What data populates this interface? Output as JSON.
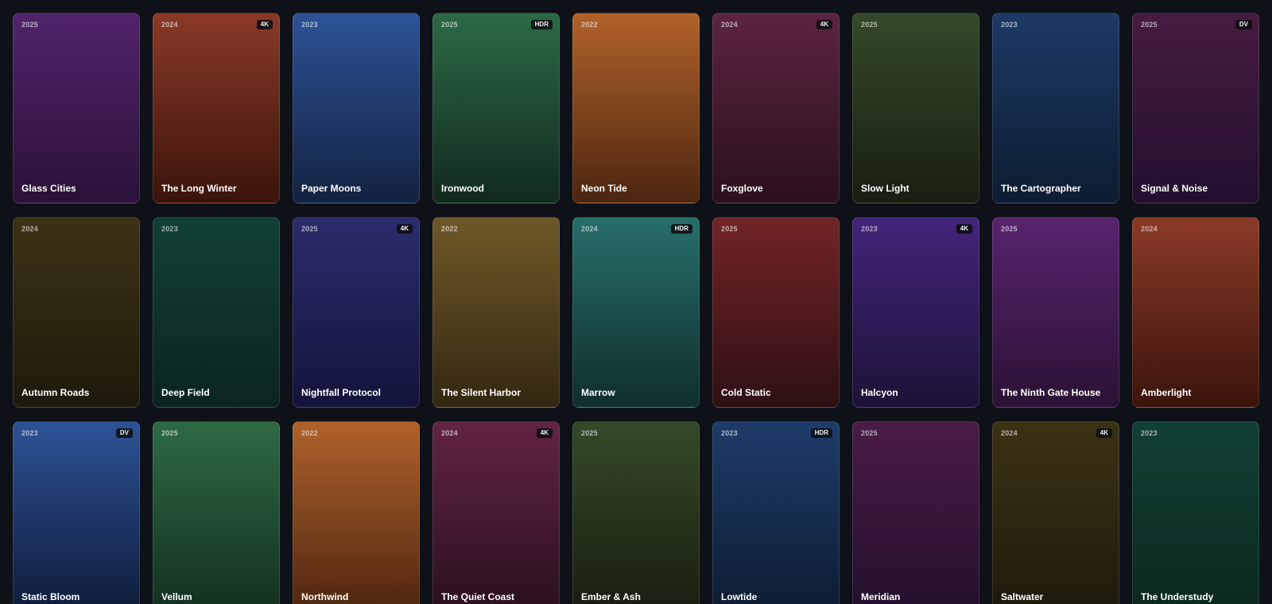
{
  "cards": [
    {
      "year": "2025",
      "badge": "",
      "title": "Glass Cities",
      "top": "#51246a",
      "bottom": "#2a1138"
    },
    {
      "year": "2024",
      "badge": "4K",
      "title": "The Long Winter",
      "top": "#8a3a27",
      "bottom": "#3a140c"
    },
    {
      "year": "2023",
      "badge": "",
      "title": "Paper Moons",
      "top": "#2c5296",
      "bottom": "#132240"
    },
    {
      "year": "2025",
      "badge": "HDR",
      "title": "Ironwood",
      "top": "#2b6a45",
      "bottom": "#112a1e"
    },
    {
      "year": "2022",
      "badge": "",
      "title": "Neon Tide",
      "top": "#b0622a",
      "bottom": "#4c260f"
    },
    {
      "year": "2024",
      "badge": "4K",
      "title": "Foxglove",
      "top": "#5c2440",
      "bottom": "#2a101c"
    },
    {
      "year": "2025",
      "badge": "",
      "title": "Slow Light",
      "top": "#34492a",
      "bottom": "#181e10"
    },
    {
      "year": "2023",
      "badge": "",
      "title": "The Cartographer",
      "top": "#1c3a66",
      "bottom": "#0d1c30"
    },
    {
      "year": "2025",
      "badge": "DV",
      "title": "Signal & Noise",
      "top": "#461c40",
      "bottom": "#22102e"
    },
    {
      "year": "2024",
      "badge": "",
      "title": "Autumn Roads",
      "top": "#3c3214",
      "bottom": "#1e1a0c"
    },
    {
      "year": "2023",
      "badge": "",
      "title": "Deep Field",
      "top": "#124034",
      "bottom": "#0b2420"
    },
    {
      "year": "2025",
      "badge": "4K",
      "title": "Nightfall Protocol",
      "top": "#2a2c6c",
      "bottom": "#13143a"
    },
    {
      "year": "2022",
      "badge": "",
      "title": "The Silent Harbor",
      "top": "#6e5828",
      "bottom": "#332810"
    },
    {
      "year": "2024",
      "badge": "HDR",
      "title": "Marrow",
      "top": "#276e6a",
      "bottom": "#0f2e2c"
    },
    {
      "year": "2025",
      "badge": "",
      "title": "Cold Static",
      "top": "#722428",
      "bottom": "#2e1012"
    },
    {
      "year": "2023",
      "badge": "4K",
      "title": "Halcyon",
      "top": "#44247a",
      "bottom": "#1c1236"
    },
    {
      "year": "2025",
      "badge": "",
      "title": "The Ninth Gate House",
      "top": "#58246e",
      "bottom": "#2a1234"
    },
    {
      "year": "2024",
      "badge": "",
      "title": "Amberlight",
      "top": "#8a3a26",
      "bottom": "#3a140c"
    },
    {
      "year": "2023",
      "badge": "DV",
      "title": "Static Bloom",
      "top": "#2c5296",
      "bottom": "#0f1c3a"
    },
    {
      "year": "2025",
      "badge": "",
      "title": "Vellum",
      "top": "#2e6a44",
      "bottom": "#133020"
    },
    {
      "year": "2022",
      "badge": "",
      "title": "Northwind",
      "top": "#b0622a",
      "bottom": "#4e2610"
    },
    {
      "year": "2024",
      "badge": "4K",
      "title": "The Quiet Coast",
      "top": "#622444",
      "bottom": "#2a101e"
    },
    {
      "year": "2025",
      "badge": "",
      "title": "Ember & Ash",
      "top": "#354a28",
      "bottom": "#181e10"
    },
    {
      "year": "2023",
      "badge": "HDR",
      "title": "Lowtide",
      "top": "#1e3c6a",
      "bottom": "#0d1c32"
    },
    {
      "year": "2025",
      "badge": "",
      "title": "Meridian",
      "top": "#4a1c44",
      "bottom": "#22102c"
    },
    {
      "year": "2024",
      "badge": "4K",
      "title": "Saltwater",
      "top": "#3c3214",
      "bottom": "#1e1a0c"
    },
    {
      "year": "2023",
      "badge": "",
      "title": "The Understudy",
      "top": "#124034",
      "bottom": "#0b2820"
    }
  ]
}
